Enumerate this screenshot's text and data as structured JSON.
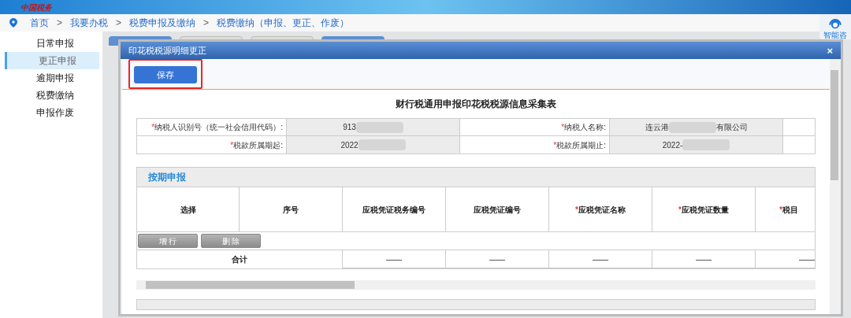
{
  "logo": "中国税务",
  "breadcrumb": [
    "首页",
    "我要办税",
    "税费申报及缴纳",
    "税费缴纳（申报、更正、作废）"
  ],
  "breadcrumb_separator": ">",
  "sidebar": [
    {
      "label": "日常申报",
      "selected": false
    },
    {
      "label": "更正申报",
      "selected": true
    },
    {
      "label": "逾期申报",
      "selected": false
    },
    {
      "label": "税费缴纳",
      "selected": false
    },
    {
      "label": "申报作废",
      "selected": false
    }
  ],
  "help_widget": {
    "label": "智能咨"
  },
  "dialog": {
    "title": "印花税税源明细更正",
    "close": "×",
    "save_button": "保存",
    "form_title": "财行税通用申报印花税税源信息采集表",
    "fields": [
      {
        "label": "纳税人识别号（统一社会信用代码）:",
        "value": "913",
        "masked": true
      },
      {
        "label": "纳税人名称:",
        "value": "连云港",
        "value_end": "有限公司",
        "masked": true
      },
      {
        "label": "税款所属期起:",
        "value": "2022",
        "masked": true
      },
      {
        "label": "税款所属期止:",
        "value": "2022-",
        "masked": true
      }
    ],
    "required_mark": "*",
    "section_title": "按期申报",
    "columns": [
      {
        "label": "选择",
        "required": false
      },
      {
        "label": "序号",
        "required": false
      },
      {
        "label": "应税凭证税务编号",
        "required": false
      },
      {
        "label": "应税凭证编号",
        "required": false
      },
      {
        "label": "应税凭证名称",
        "required": true
      },
      {
        "label": "应税凭证数量",
        "required": true
      },
      {
        "label": "税目",
        "required": true
      }
    ],
    "row_buttons": [
      "增 行",
      "删 除"
    ],
    "total_label": "合计",
    "total_cells": [
      "——",
      "——",
      "——",
      "——",
      "——"
    ]
  }
}
